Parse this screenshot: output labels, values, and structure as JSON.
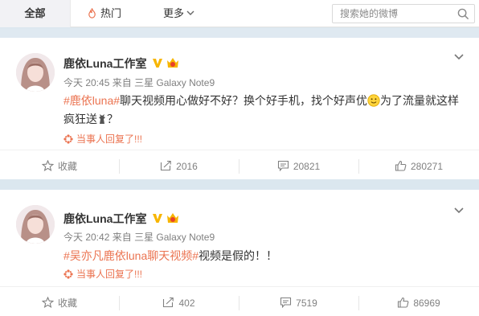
{
  "topbar": {
    "tabs": [
      {
        "label": "全部",
        "active": true
      },
      {
        "label": "热门",
        "icon": "fire-icon"
      },
      {
        "label": "更多",
        "icon": "chevron-down-icon"
      }
    ],
    "search": {
      "placeholder": "搜索她的微博"
    }
  },
  "colors": {
    "accent": "#eb7350",
    "verified": "#f7b500",
    "link": "#eb7350"
  },
  "posts": [
    {
      "author": "鹿依Luna工作室",
      "time": "今天 20:45",
      "source_prefix": "来自",
      "source": "三星 Galaxy Note9",
      "content_tag": "#鹿依luna#",
      "content_text_1": "聊天视频用心做好不好？换个好手机，找个好声优",
      "content_text_2": "为了流量就这样疯狂送",
      "content_text_3": "？",
      "reply_text": "当事人回复了!!!",
      "actions": {
        "favorite": "收藏",
        "repost": "2016",
        "comment": "20821",
        "like": "280271"
      }
    },
    {
      "author": "鹿依Luna工作室",
      "time": "今天 20:42",
      "source_prefix": "来自",
      "source": "三星 Galaxy Note9",
      "content_tag": "#吴亦凡鹿依luna聊天视频#",
      "content_text_1": "视频是假的！！",
      "reply_text": "当事人回复了!!!",
      "actions": {
        "favorite": "收藏",
        "repost": "402",
        "comment": "7519",
        "like": "86969"
      }
    }
  ]
}
